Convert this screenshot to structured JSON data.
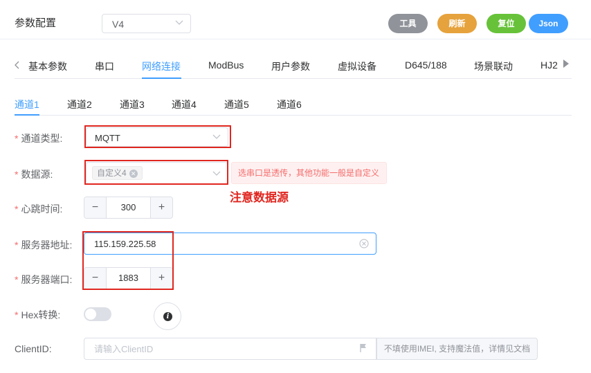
{
  "header": {
    "title": "参数配置",
    "version_select": "V4",
    "buttons": {
      "tool": "工具",
      "refresh": "刷新",
      "reset": "复位",
      "json": "Json"
    }
  },
  "main_tabs": [
    "基本参数",
    "串口",
    "网络连接",
    "ModBus",
    "用户参数",
    "虚拟设备",
    "D645/188",
    "场景联动",
    "HJ2"
  ],
  "active_main_tab": "网络连接",
  "channel_tabs": [
    "通道1",
    "通道2",
    "通道3",
    "通道4",
    "通道5",
    "通道6"
  ],
  "active_channel_tab": "通道1",
  "form": {
    "channel_type": {
      "label": "通道类型:",
      "value": "MQTT"
    },
    "data_source": {
      "label": "数据源:",
      "tag": "自定义4",
      "hint": "选串口是透传，其他功能一般是自定义"
    },
    "heartbeat": {
      "label": "心跳时间:",
      "value": "300",
      "minus": "−",
      "plus": "+"
    },
    "server_address": {
      "label": "服务器地址:",
      "value": "115.159.225.58"
    },
    "server_port": {
      "label": "服务器端口:",
      "value": "1883",
      "minus": "−",
      "plus": "+"
    },
    "hex_convert": {
      "label": "Hex转换:",
      "enabled": false,
      "info": "i"
    },
    "client_id": {
      "label": "ClientID:",
      "placeholder": "请输入ClientID",
      "append": "不填使用IMEI, 支持魔法值，详情见文档"
    }
  },
  "annotation": {
    "note": "注意数据源",
    "color": "#e0261f"
  },
  "colors": {
    "primary": "#409eff",
    "danger": "#f56c6c",
    "warning": "#e6a23c",
    "success": "#67c23a",
    "info": "#909399"
  }
}
